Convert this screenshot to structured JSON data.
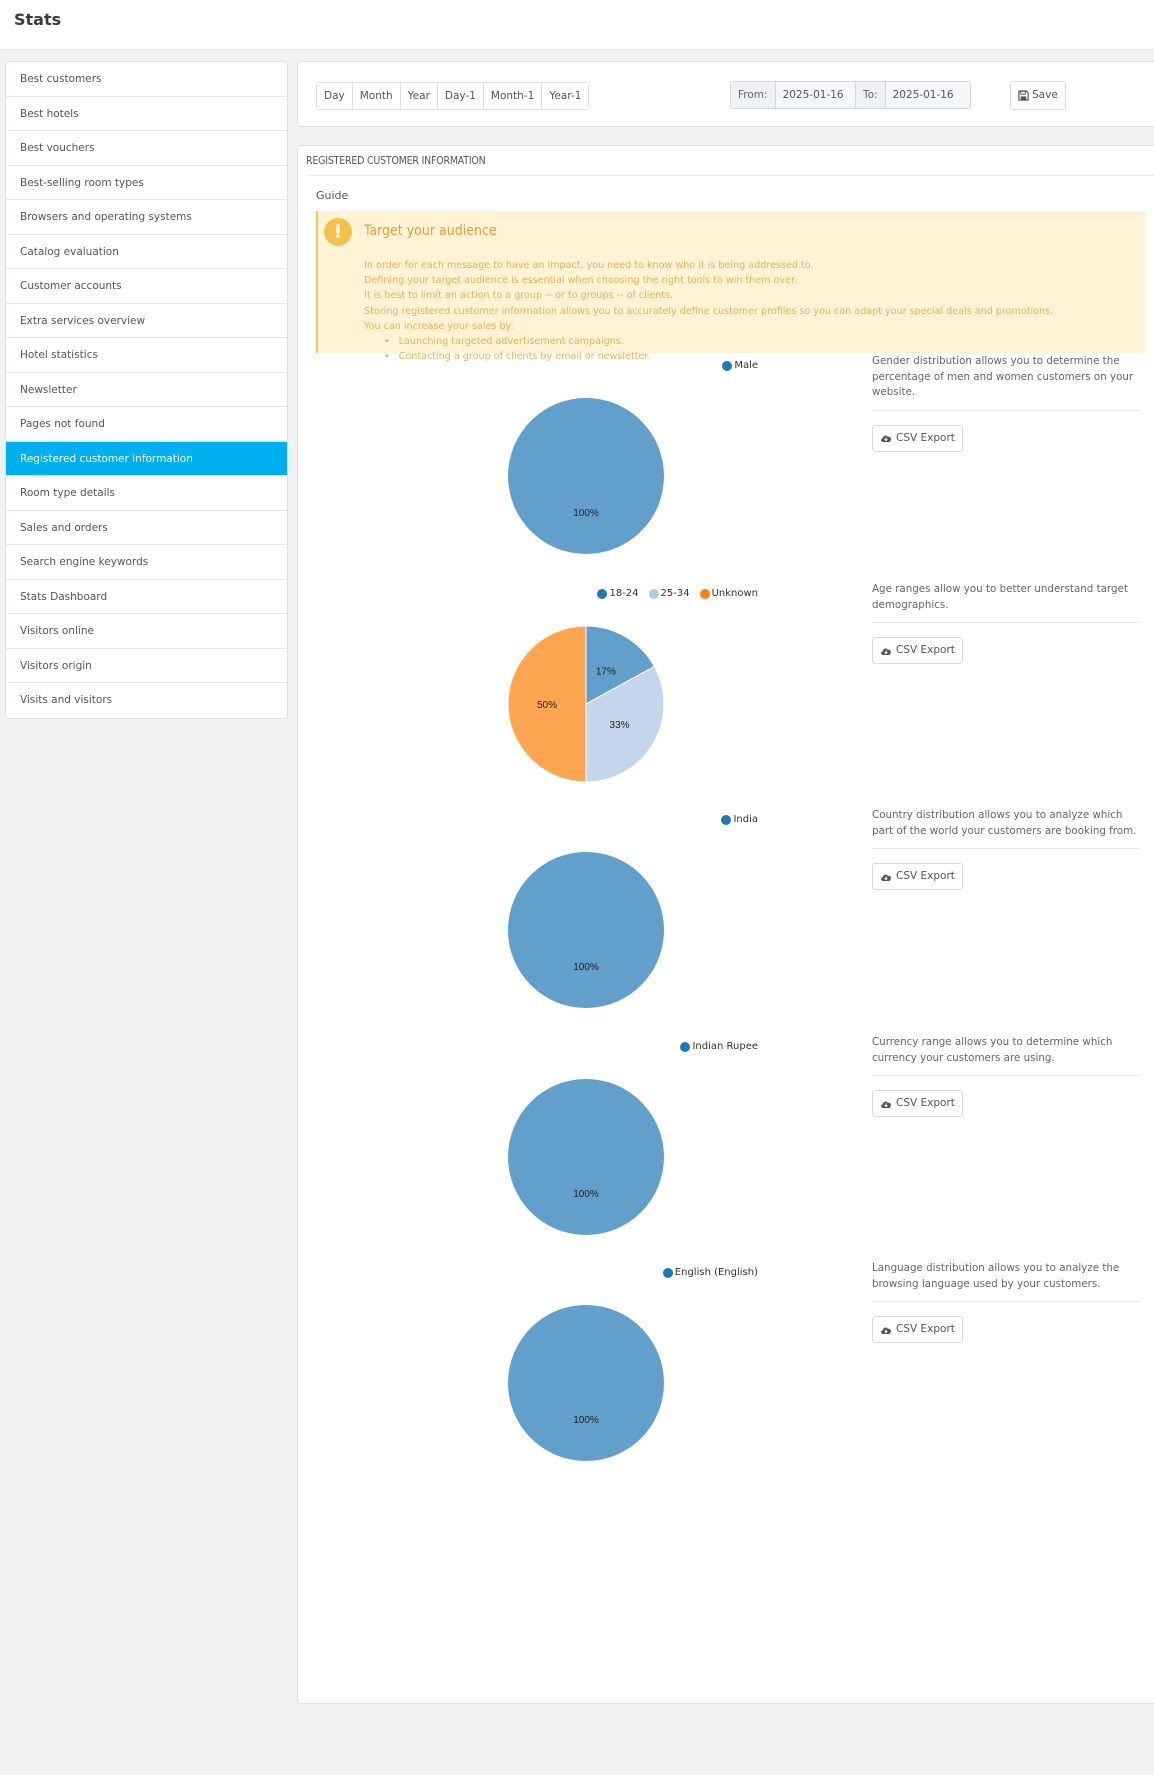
{
  "page": {
    "title": "Stats"
  },
  "sidebar": {
    "active_index": 11,
    "items": [
      {
        "label": "Best customers"
      },
      {
        "label": "Best hotels"
      },
      {
        "label": "Best vouchers"
      },
      {
        "label": "Best-selling room types"
      },
      {
        "label": "Browsers and operating systems"
      },
      {
        "label": "Catalog evaluation"
      },
      {
        "label": "Customer accounts"
      },
      {
        "label": "Extra services overview"
      },
      {
        "label": "Hotel statistics"
      },
      {
        "label": "Newsletter"
      },
      {
        "label": "Pages not found"
      },
      {
        "label": "Registered customer information"
      },
      {
        "label": "Room type details"
      },
      {
        "label": "Sales and orders"
      },
      {
        "label": "Search engine keywords"
      },
      {
        "label": "Stats Dashboard"
      },
      {
        "label": "Visitors online"
      },
      {
        "label": "Visitors origin"
      },
      {
        "label": "Visits and visitors"
      }
    ]
  },
  "toolbar": {
    "periods": [
      "Day",
      "Month",
      "Year",
      "Day-1",
      "Month-1",
      "Year-1"
    ],
    "from_label": "From:",
    "from_value": "2025-01-16",
    "to_label": "To:",
    "to_value": "2025-01-16",
    "save_label": "Save",
    "save_icon": "floppy-disk-icon"
  },
  "panel": {
    "heading": "REGISTERED CUSTOMER INFORMATION",
    "guide_label": "Guide",
    "alert": {
      "icon": "exclamation-icon",
      "title": "Target your audience",
      "lines": [
        "In order for each message to have an impact, you need to know who it is being addressed to.",
        "Defining your target audience is essential when choosing the right tools to win them over.",
        "It is best to limit an action to a group -- or to groups -- of clients.",
        "Storing registered customer information allows you to accurately define customer profiles so you can adapt your special deals and promotions.",
        "You can increase your sales by:"
      ],
      "bullets": [
        "Launching targeted advertisement campaigns.",
        "Contacting a group of clients by email or newsletter."
      ]
    },
    "csv_export_label": "CSV Export",
    "csv_icon": "cloud-download-icon",
    "descriptions": [
      "Gender distribution allows you to determine the percentage of men and women customers on your website.",
      "Age ranges allow you to better understand target demographics.",
      "Country distribution allows you to analyze which part of the world your customers are booking from.",
      "Currency range allows you to determine which currency your customers are using.",
      "Language distribution allows you to analyze the browsing language used by your customers."
    ]
  },
  "colors": {
    "accent": "#00aff0",
    "series_blue": "#629fcb",
    "series_blue_dot": "#1f77b4",
    "series_lightblue": "#c5d6ec",
    "series_lightblue_dot": "#aec7e8",
    "series_orange": "#fda550",
    "series_orange_dot": "#ff7f0e"
  },
  "chart_data": [
    {
      "type": "pie",
      "title": "Gender distribution",
      "categories": [
        "Male"
      ],
      "values": [
        100
      ],
      "labels": [
        "100%"
      ],
      "legend": "top-right"
    },
    {
      "type": "pie",
      "title": "Age ranges",
      "categories": [
        "18-24",
        "25-34",
        "Unknown"
      ],
      "values": [
        17,
        33,
        50
      ],
      "labels": [
        "17%",
        "33%",
        "50%"
      ],
      "legend": "top-right"
    },
    {
      "type": "pie",
      "title": "Country distribution",
      "categories": [
        "India"
      ],
      "values": [
        100
      ],
      "labels": [
        "100%"
      ],
      "legend": "top-right"
    },
    {
      "type": "pie",
      "title": "Currency range",
      "categories": [
        "Indian Rupee"
      ],
      "values": [
        100
      ],
      "labels": [
        "100%"
      ],
      "legend": "top-right"
    },
    {
      "type": "pie",
      "title": "Language distribution",
      "categories": [
        "English (English)"
      ],
      "values": [
        100
      ],
      "labels": [
        "100%"
      ],
      "legend": "top-right"
    }
  ]
}
